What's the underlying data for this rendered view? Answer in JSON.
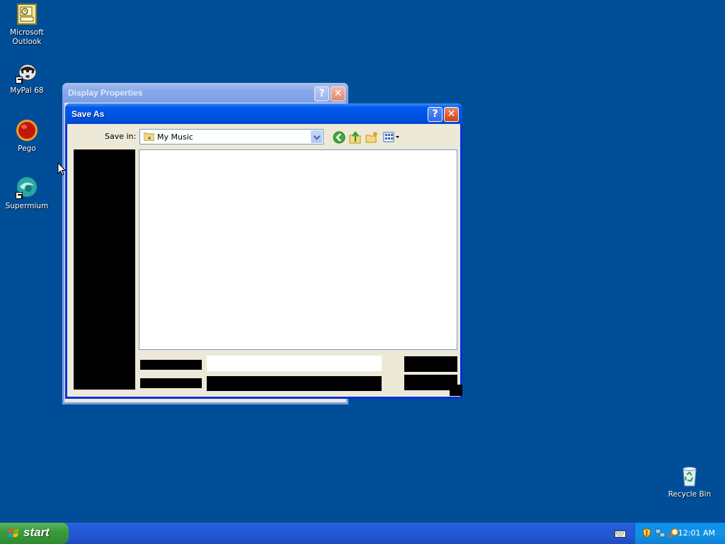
{
  "desktop": {
    "icons": [
      {
        "label": "Microsoft Outlook",
        "icon": "outlook-icon"
      },
      {
        "label": "MyPal 68",
        "icon": "mypal-icon"
      },
      {
        "label": "Pego",
        "icon": "pego-icon"
      },
      {
        "label": "Supermium",
        "icon": "supermium-icon"
      },
      {
        "label": "Recycle Bin",
        "icon": "recycle-bin-icon"
      }
    ]
  },
  "background_window": {
    "title": "Display Properties",
    "help_glyph": "?",
    "close_glyph": "✕"
  },
  "dialog": {
    "title": "Save As",
    "help_glyph": "?",
    "close_glyph": "✕",
    "save_in_label": "Save in:",
    "save_in_value": "My Music",
    "toolbar_icons": [
      "back-icon",
      "up-folder-icon",
      "new-folder-icon",
      "views-menu-icon"
    ]
  },
  "taskbar": {
    "start_label": "start",
    "clock": "12:01 AM",
    "tray_icons": [
      "keyboard-icon",
      "security-shield-icon",
      "network-icon",
      "search-icon"
    ]
  },
  "colors": {
    "desktop_bg": "#004e98",
    "titlebar_active": "#0054e3",
    "titlebar_inactive": "#7b9fe6",
    "window_face": "#ece9d8",
    "start_green": "#3c9c3c"
  }
}
